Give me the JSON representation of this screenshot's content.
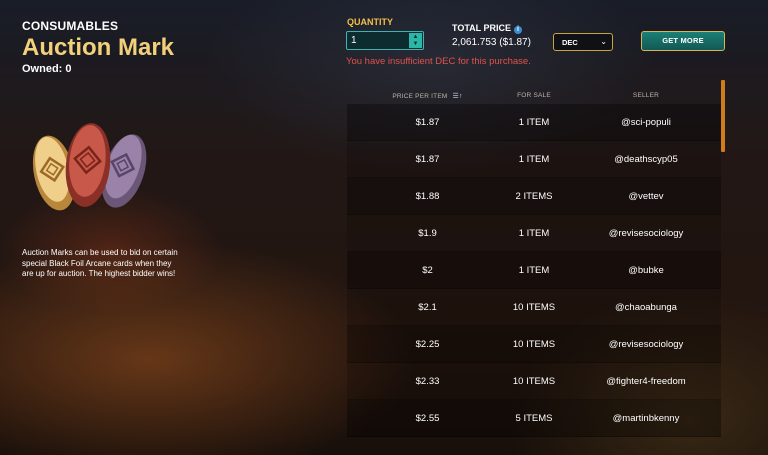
{
  "item": {
    "category": "CONSUMABLES",
    "name": "Auction Mark",
    "owned_label": "Owned:",
    "owned_count": "0",
    "description": "Auction Marks can be used to bid on certain special Black Foil Arcane cards when they are up for auction. The highest bidder wins!",
    "art_icon": "auction-mark-stones-icon"
  },
  "purchase": {
    "quantity_label": "QUANTITY",
    "quantity_value": "1",
    "total_price_label": "TOTAL PRICE",
    "total_price_value": "2,061.753 ($1.87)",
    "currency": "DEC",
    "get_more_label": "GET MORE",
    "warning": "You have insufficient DEC for this purchase."
  },
  "table": {
    "headers": {
      "price": "PRICE PER ITEM",
      "for_sale": "FOR SALE",
      "seller": "SELLER"
    },
    "rows": [
      {
        "price": "$1.87",
        "for_sale": "1 ITEM",
        "seller": "@sci-populi"
      },
      {
        "price": "$1.87",
        "for_sale": "1 ITEM",
        "seller": "@deathscyp05"
      },
      {
        "price": "$1.88",
        "for_sale": "2 ITEMS",
        "seller": "@vettev"
      },
      {
        "price": "$1.9",
        "for_sale": "1 ITEM",
        "seller": "@revisesociology"
      },
      {
        "price": "$2",
        "for_sale": "1 ITEM",
        "seller": "@bubke"
      },
      {
        "price": "$2.1",
        "for_sale": "10 ITEMS",
        "seller": "@chaoabunga"
      },
      {
        "price": "$2.25",
        "for_sale": "10 ITEMS",
        "seller": "@revisesociology"
      },
      {
        "price": "$2.33",
        "for_sale": "10 ITEMS",
        "seller": "@fighter4-freedom"
      },
      {
        "price": "$2.55",
        "for_sale": "5 ITEMS",
        "seller": "@martinbkenny"
      }
    ]
  },
  "colors": {
    "title_gold": "#f3d17a",
    "warning_red": "#e2524b",
    "accent_teal": "#1c7f76",
    "scrollbar_orange": "#d07c1a"
  }
}
